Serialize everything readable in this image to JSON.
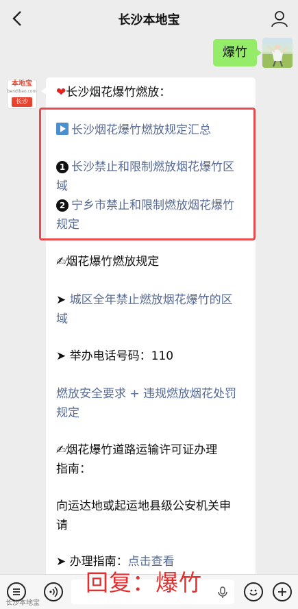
{
  "header": {
    "title": "长沙本地宝"
  },
  "user": {
    "message": "爆竹"
  },
  "bot": {
    "avatar_brand": "本地宝",
    "avatar_sub": "bendibao.com",
    "avatar_city": "长沙",
    "intro": "长沙烟花爆竹燃放：",
    "summary_link": "长沙烟花爆竹燃放规定汇总",
    "item1_num": "1",
    "item1_line1": "长沙禁止和限制燃放烟花爆竹区",
    "item1_line2": "域",
    "item2_num": "2",
    "item2_line1": "宁乡市禁止和限制燃放烟花爆竹",
    "item2_line2": "规定",
    "section1_title": "烟花爆竹燃放规定",
    "citywide_line1": "城区全年禁止燃放烟花爆竹的区",
    "citywide_line2": "域",
    "phone_prefix": "举办电话号码：",
    "phone": "110",
    "safety_line1": "燃放安全要求 + 违规燃放烟花处罚",
    "safety_line2": "规定",
    "section2_line1": "烟花爆竹道路运输许可证办理",
    "section2_line2": "指南：",
    "apply_line1": "向运达地或起运地县级公安机关申",
    "apply_line2": "请",
    "guide_prefix": "办理指南：",
    "guide_link": "点击查看"
  },
  "overlay": {
    "reply_text": "回复：爆竹"
  },
  "watermark": {
    "text": "长沙本地宝"
  },
  "icons": {
    "back": "chevron-left-icon",
    "profile": "person-icon",
    "voice": "voice-icon",
    "emoji": "emoji-icon",
    "add": "plus-icon",
    "mic": "mic-icon"
  },
  "colors": {
    "link": "#576b95",
    "user_bubble": "#95ec69",
    "highlight_border": "#e84b4b",
    "overlay_text": "#e23030"
  }
}
